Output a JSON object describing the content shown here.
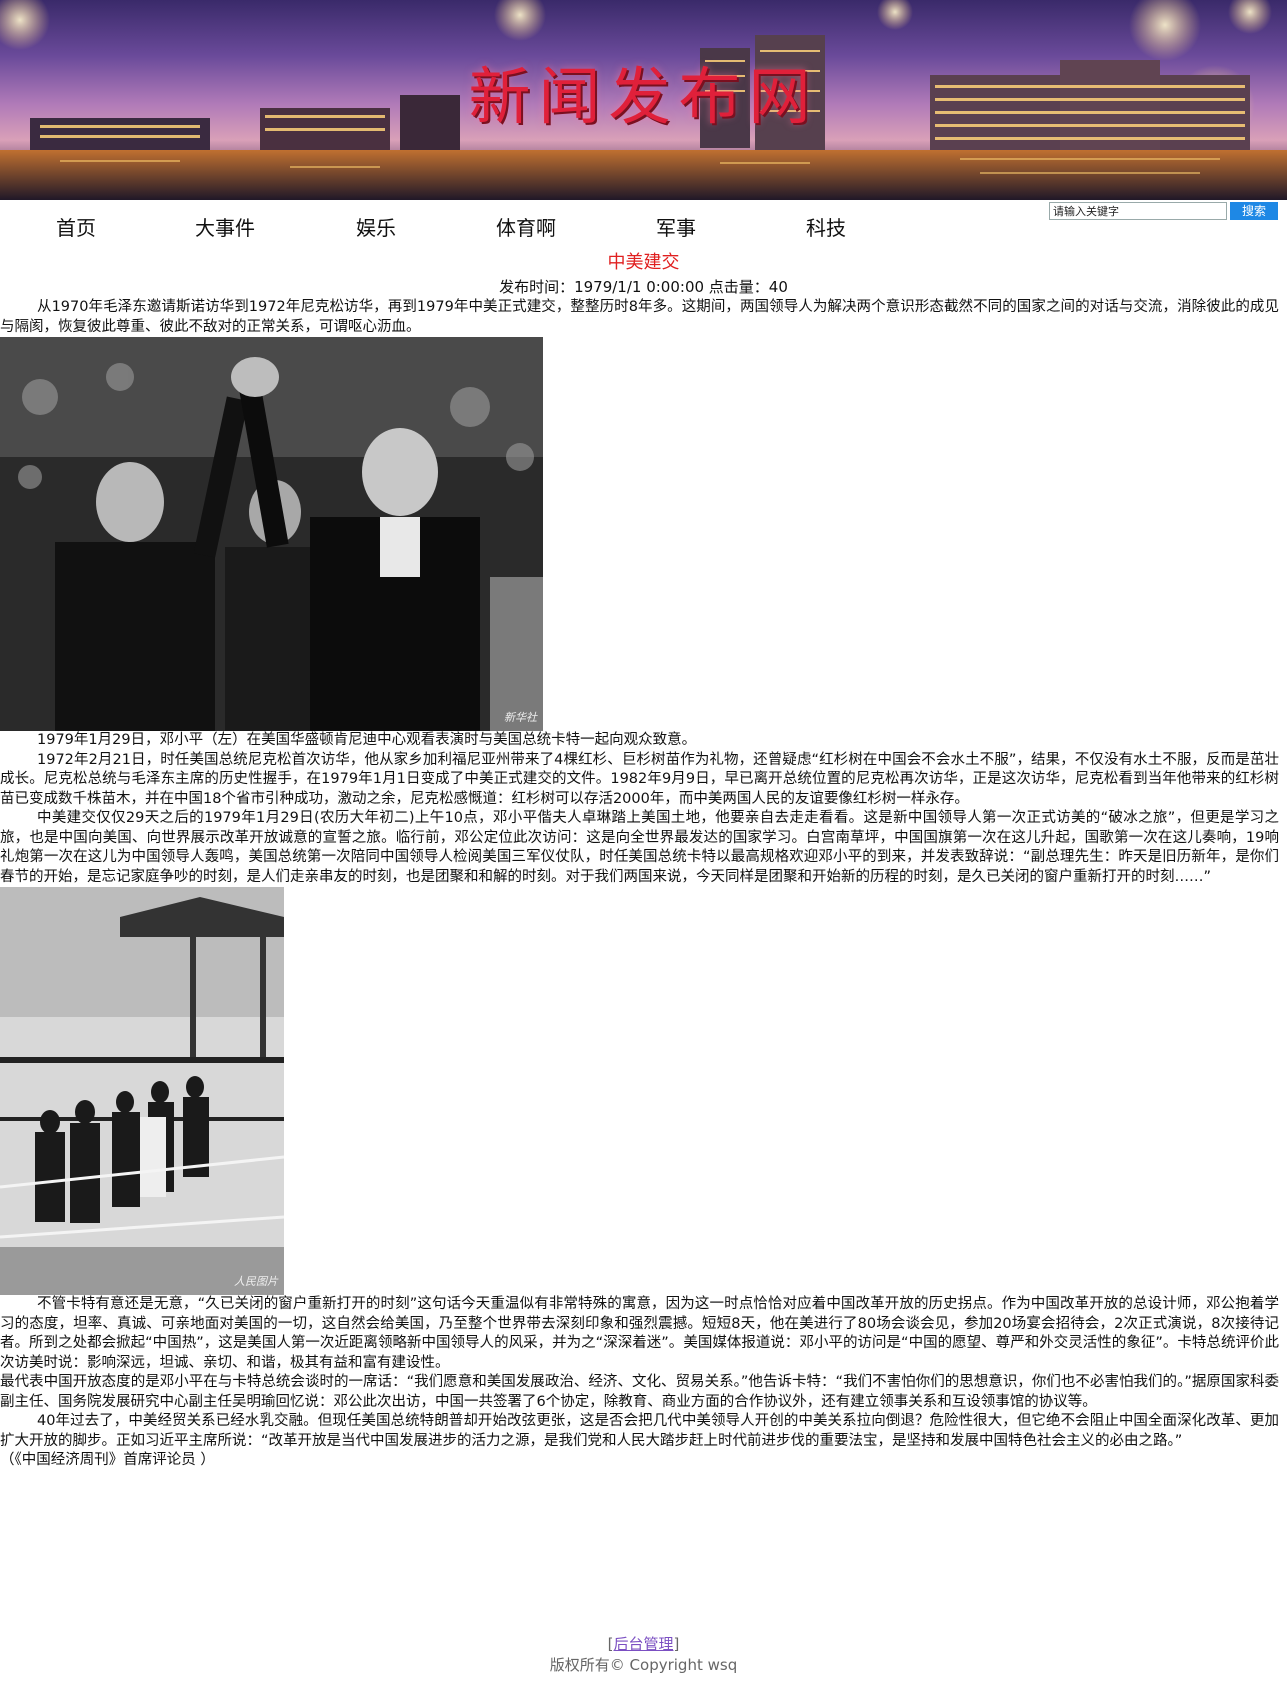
{
  "banner": {
    "site_title": "新闻发布网"
  },
  "nav": {
    "items": [
      {
        "label": "首页"
      },
      {
        "label": "大事件"
      },
      {
        "label": "娱乐"
      },
      {
        "label": "体育啊"
      },
      {
        "label": "军事"
      },
      {
        "label": "科技"
      }
    ]
  },
  "search": {
    "value": "请输入关键字",
    "button_label": "搜索"
  },
  "article": {
    "title": "中美建交",
    "meta": "发布时间：1979/1/1 0:00:00    点击量：40",
    "para1": "从1970年毛泽东邀请斯诺访华到1972年尼克松访华，再到1979年中美正式建交，整整历时8年多。这期间，两国领导人为解决两个意识形态截然不同的国家之间的对话与交流，消除彼此的成见与隔阂，恢复彼此尊重、彼此不敌对的正常关系，可谓呕心沥血。",
    "photo1_mark": "新华社",
    "caption1": "1979年1月29日，邓小平（左）在美国华盛顿肯尼迪中心观看表演时与美国总统卡特一起向观众致意。",
    "para2": "1972年2月21日，时任美国总统尼克松首次访华，他从家乡加利福尼亚州带来了4棵红杉、巨杉树苗作为礼物，还曾疑虑“红杉树在中国会不会水土不服”，结果，不仅没有水土不服，反而是茁壮成长。尼克松总统与毛泽东主席的历史性握手，在1979年1月1日变成了中美正式建交的文件。1982年9月9日，早已离开总统位置的尼克松再次访华，正是这次访华，尼克松看到当年他带来的红杉树苗已变成数千株苗木，并在中国18个省市引种成功，激动之余，尼克松感慨道：红杉树可以存活2000年，而中美两国人民的友谊要像红杉树一样永存。",
    "para3": "中美建交仅仅29天之后的1979年1月29日(农历大年初二)上午10点，邓小平偕夫人卓琳踏上美国土地，他要亲自去走走看看。这是新中国领导人第一次正式访美的“破冰之旅”，但更是学习之旅，也是中国向美国、向世界展示改革开放诚意的宣誓之旅。临行前，邓公定位此次访问：这是向全世界最发达的国家学习。白宫南草坪，中国国旗第一次在这儿升起，国歌第一次在这儿奏响，19响礼炮第一次在这儿为中国领导人轰鸣，美国总统第一次陪同中国领导人检阅美国三军仪仗队，时任美国总统卡特以最高规格欢迎邓小平的到来，并发表致辞说：“副总理先生：昨天是旧历新年，是你们春节的开始，是忘记家庭争吵的时刻，是人们走亲串友的时刻，也是团聚和和解的时刻。对于我们两国来说，今天同样是团聚和开始新的历程的时刻，是久已关闭的窗户重新打开的时刻……”",
    "photo2_mark": "人民图片",
    "para4": "不管卡特有意还是无意，“久已关闭的窗户重新打开的时刻”这句话今天重温似有非常特殊的寓意，因为这一时点恰恰对应着中国改革开放的历史拐点。作为中国改革开放的总设计师，邓公抱着学习的态度，坦率、真诚、可亲地面对美国的一切，这自然会给美国，乃至整个世界带去深刻印象和强烈震撼。短短8天，他在美进行了80场会谈会见，参加20场宴会招待会，2次正式演说，8次接待记者。所到之处都会掀起“中国热”，这是美国人第一次近距离领略新中国领导人的风采，并为之“深深着迷”。美国媒体报道说：邓小平的访问是“中国的愿望、尊严和外交灵活性的象征”。卡特总统评价此次访美时说：影响深远，坦诚、亲切、和谐，极其有益和富有建设性。",
    "para5": "最代表中国开放态度的是邓小平在与卡特总统会谈时的一席话：“我们愿意和美国发展政治、经济、文化、贸易关系。”他告诉卡特：“我们不害怕你们的思想意识，你们也不必害怕我们的。”据原国家科委副主任、国务院发展研究中心副主任吴明瑜回忆说：邓公此次出访，中国一共签署了6个协定，除教育、商业方面的合作协议外，还有建立领事关系和互设领事馆的协议等。",
    "para6": "40年过去了，中美经贸关系已经水乳交融。但现任美国总统特朗普却开始改弦更张，这是否会把几代中美领导人开创的中美关系拉向倒退？危险性很大，但它绝不会阻止中国全面深化改革、更加扩大开放的脚步。正如习近平主席所说：“改革开放是当代中国发展进步的活力之源，是我们党和人民大踏步赶上时代前进步伐的重要法宝，是坚持和发展中国特色社会主义的必由之路。”",
    "source": "（《中国经济周刊》首席评论员 ）"
  },
  "footer": {
    "admin_prefix": "[",
    "admin_link": "后台管理",
    "admin_suffix": "]",
    "copyright": "版权所有© Copyright wsq"
  }
}
